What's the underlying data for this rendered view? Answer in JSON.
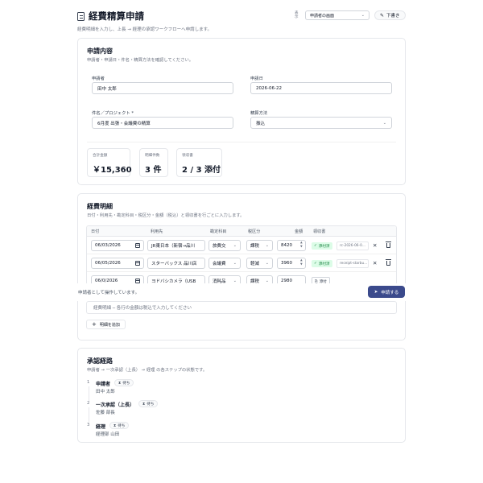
{
  "header": {
    "title": "経費精算申請",
    "subtitle": "経費明細を入力し、上長 → 経理の承認ワークフローへ申請します。",
    "display_label": "表示",
    "display_value": "申請者の画面",
    "draft_label": "下書き"
  },
  "request": {
    "title": "申請内容",
    "subtitle": "申請者・申請日・件名・精算方法を確認してください。",
    "applicant_label": "申請者",
    "applicant_value": "田中 太郎",
    "date_label": "申請日",
    "date_value": "2026-06-22",
    "subject_label": "件名／プロジェクト *",
    "subject_value": "6月度 出張・会議費の精算",
    "method_label": "精算方法",
    "method_value": "振込",
    "stats": [
      {
        "label": "合計金額",
        "value": "￥15,360"
      },
      {
        "label": "明細件数",
        "value": "3 件"
      },
      {
        "label": "領収書",
        "value": "2 / 3 添付"
      }
    ]
  },
  "details": {
    "title": "経費明細",
    "subtitle": "日付・利用先・勘定科目・税区分・金額（税込）と領収書を行ごとに入力します。",
    "columns": [
      "日付",
      "利用先",
      "勘定科目",
      "税区分",
      "金額",
      "領収書"
    ],
    "rows": [
      {
        "date": "06/03/2026",
        "payee": "JR東日本（新宿→品川",
        "account": "旅費交",
        "tax": "課税",
        "amount": "8420",
        "receipt_status": "添付済",
        "receipt_file": "rc-2026-06-0..."
      },
      {
        "date": "06/05/2026",
        "payee": "スターバックス 品川店",
        "account": "会議費",
        "tax": "軽減",
        "amount": "3960",
        "receipt_status": "添付済",
        "receipt_file": "receipt-starbu..."
      },
      {
        "date": "06/0/2026",
        "payee": "ヨドバシカメラ（USB",
        "account": "消耗品",
        "tax": "課税",
        "amount": "2980",
        "attach_label": "添付"
      }
    ],
    "note_placeholder": "経費明細 ─ 各行の金額は税込で入力してください",
    "add_label": "明細を追加"
  },
  "sticky": {
    "text": "申請者として操作しています。",
    "submit_label": "申請する"
  },
  "approval": {
    "title": "承認経路",
    "subtitle": "申請者 → 一次承認（上長） → 経理 の各ステップの状態です。",
    "steps": [
      {
        "index": "1",
        "name": "申請者",
        "status": "待ち",
        "person": "田中 太郎"
      },
      {
        "index": "2",
        "name": "一次承認（上長）",
        "status": "待ち",
        "person": "佐藤 部長"
      },
      {
        "index": "3",
        "name": "経理",
        "status": "待ち",
        "person": "経理部 山田"
      }
    ]
  },
  "colors": {
    "primary": "#3b4a8c",
    "success_bg": "#dcfce7",
    "success_text": "#15803d",
    "border": "#e5e7eb"
  }
}
